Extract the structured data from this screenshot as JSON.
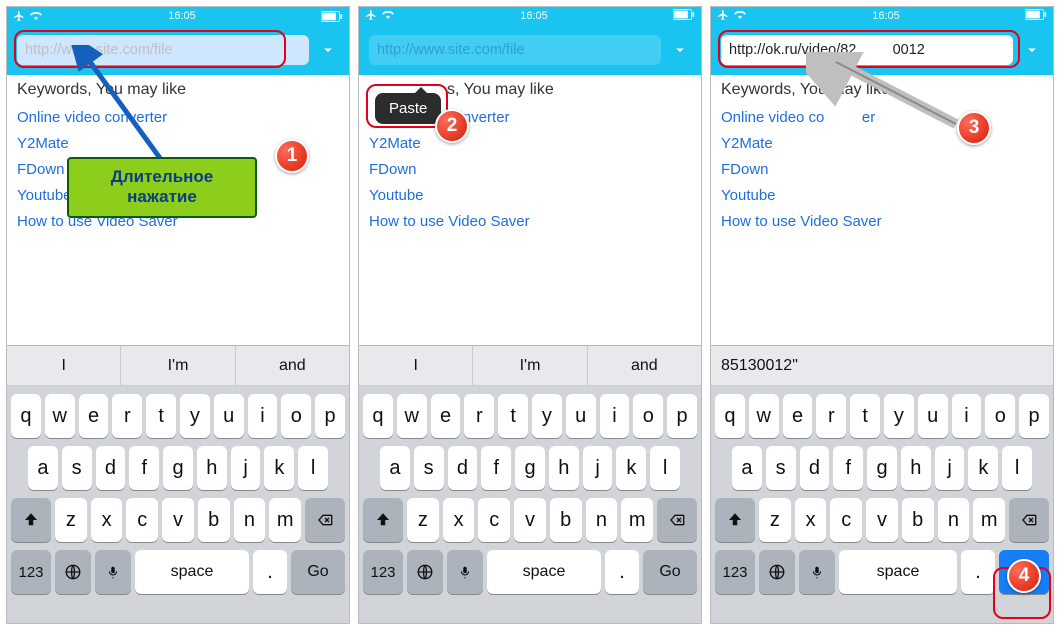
{
  "status": {
    "time": "16:05"
  },
  "urlbar": {
    "placeholder": "http://www.site.com/file"
  },
  "keywords": {
    "title": "Keywords, You may like",
    "items": [
      "Online video converter",
      "Y2Mate",
      "FDown",
      "Youtube",
      "How to use Video Saver"
    ]
  },
  "predictions": {
    "p1": "I",
    "p2": "I'm",
    "p3": "and"
  },
  "pastedUrl": "http://ok.ru/video/82         0012",
  "pastedPrediction": "85130012\"",
  "keyboard": {
    "row1": [
      "q",
      "w",
      "e",
      "r",
      "t",
      "y",
      "u",
      "i",
      "o",
      "p"
    ],
    "row2": [
      "a",
      "s",
      "d",
      "f",
      "g",
      "h",
      "j",
      "k",
      "l"
    ],
    "row3": [
      "z",
      "x",
      "c",
      "v",
      "b",
      "n",
      "m"
    ],
    "num": "123",
    "space": "space",
    "dot": ".",
    "go": "Go"
  },
  "paste": {
    "label": "Paste"
  },
  "callout1": {
    "line1": "Длительное",
    "line2": "нажатие"
  },
  "markers": {
    "m1": "1",
    "m2": "2",
    "m3": "3",
    "m4": "4"
  }
}
